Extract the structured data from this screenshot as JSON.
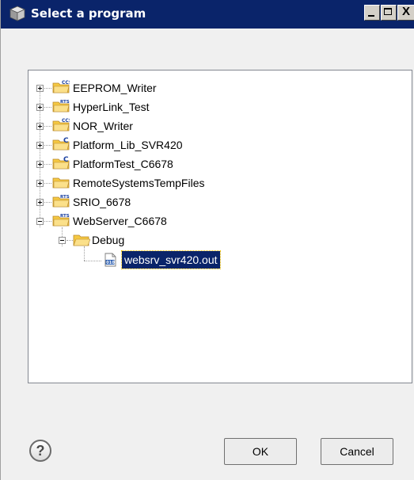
{
  "window": {
    "title": "Select a program",
    "controls": {
      "minimize": "_",
      "maximize": "□",
      "close": "X"
    }
  },
  "tree": {
    "items": [
      {
        "label": "EEPROM_Writer",
        "badge": "CCS",
        "expanded": false
      },
      {
        "label": "HyperLink_Test",
        "badge": "RTSC",
        "expanded": false
      },
      {
        "label": "NOR_Writer",
        "badge": "CCS",
        "expanded": false
      },
      {
        "label": "Platform_Lib_SVR420",
        "badge": "C",
        "expanded": false
      },
      {
        "label": "PlatformTest_C6678",
        "badge": "C",
        "expanded": false
      },
      {
        "label": "RemoteSystemsTempFiles",
        "badge": "",
        "expanded": false
      },
      {
        "label": "SRIO_6678",
        "badge": "RTSC",
        "expanded": false
      },
      {
        "label": "WebServer_C6678",
        "badge": "RTSC",
        "expanded": true
      },
      {
        "label": "Debug",
        "expanded": true
      },
      {
        "label": "websrv_svr420.out",
        "selected": true
      }
    ]
  },
  "buttons": {
    "ok": "OK",
    "cancel": "Cancel",
    "help": "?"
  },
  "colors": {
    "title_bar": "#0a246a",
    "selection": "#0a246a",
    "folder": "#f5c842"
  }
}
